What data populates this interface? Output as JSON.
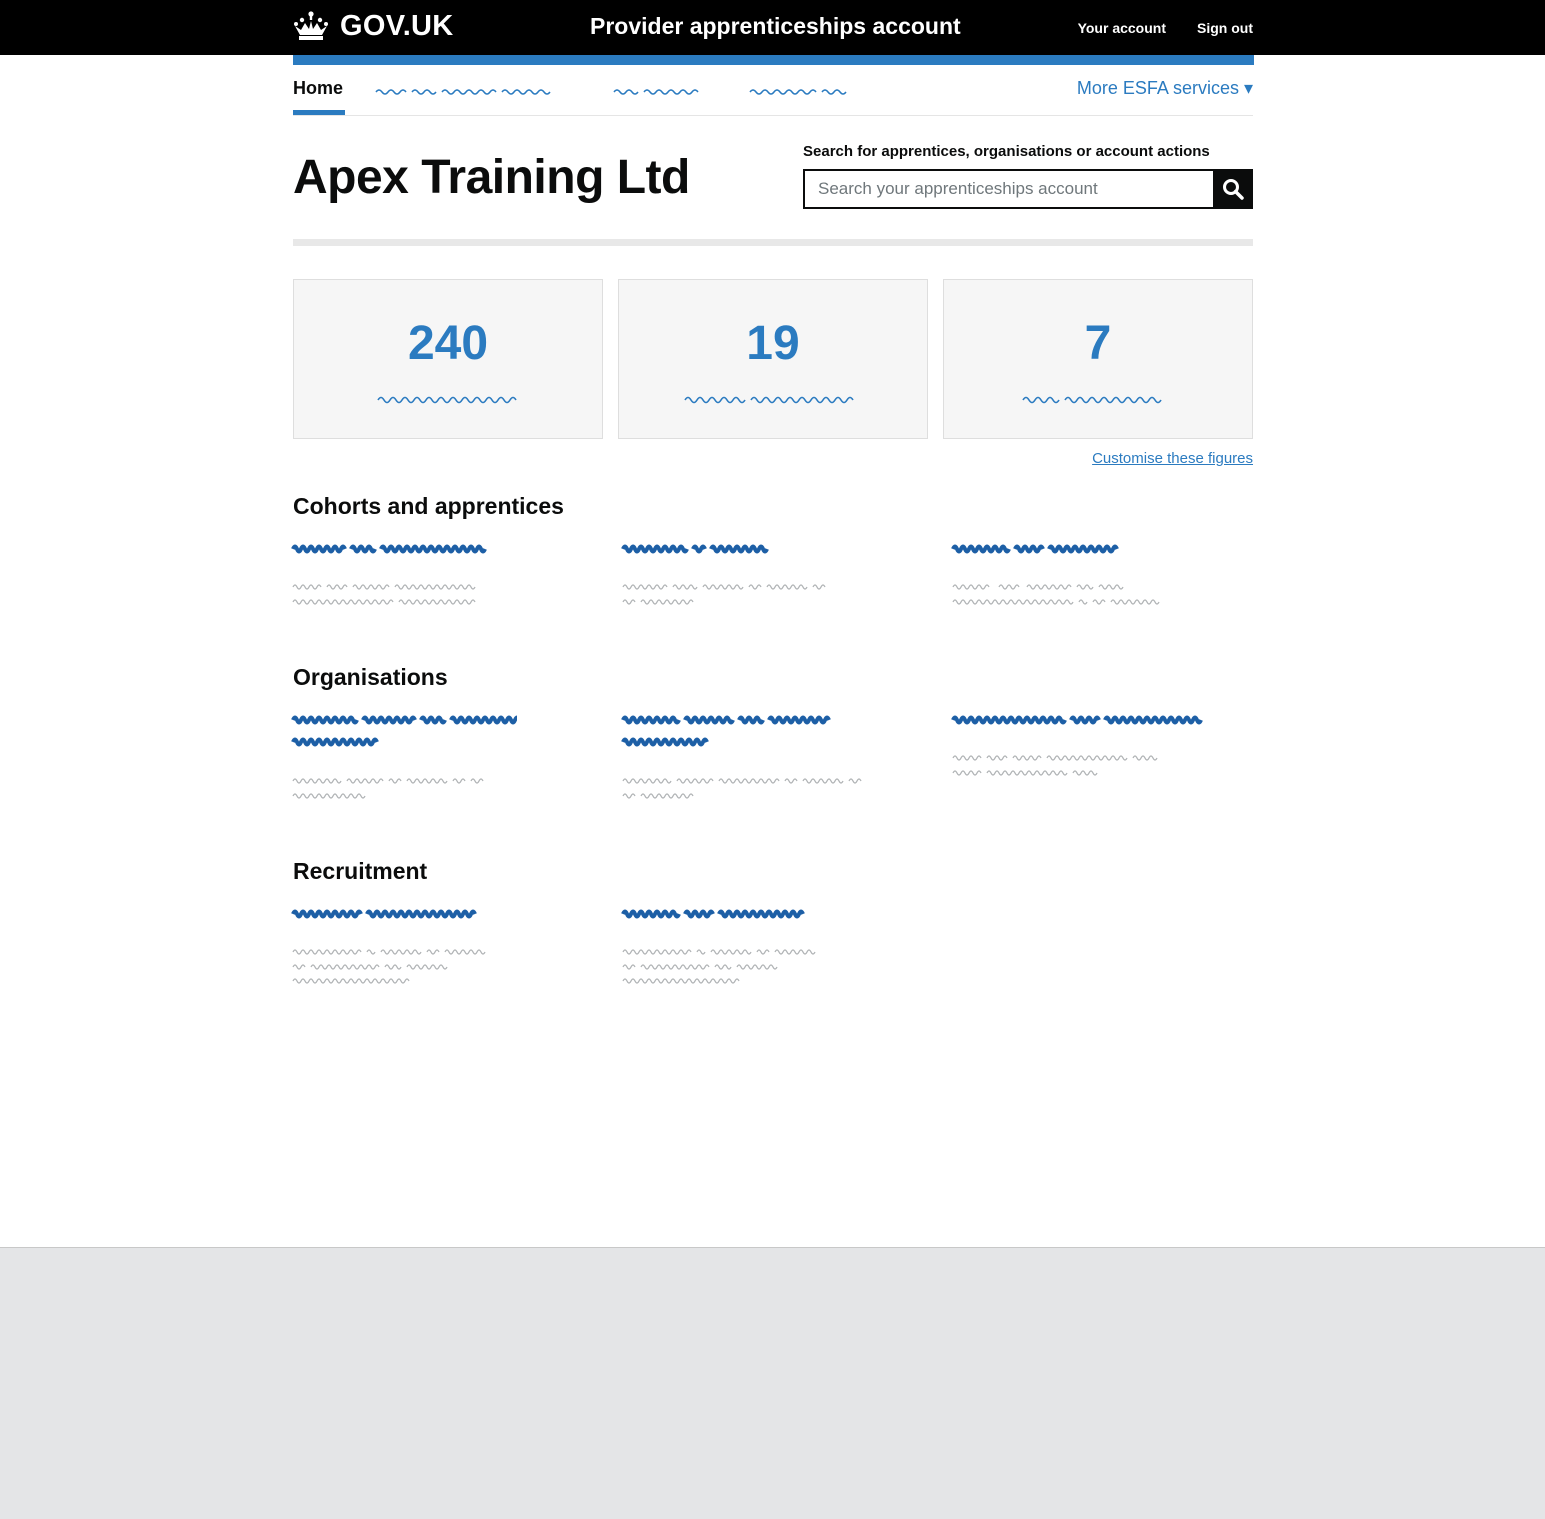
{
  "header": {
    "logo_text": "GOV.UK",
    "service_name": "Provider apprenticeships account",
    "links": [
      "Your account",
      "Sign out"
    ]
  },
  "nav": {
    "home": "Home",
    "more_services": "More ESFA services ▾"
  },
  "page_title": "Apex Training Ltd",
  "search": {
    "label": "Search for apprentices, organisations or account actions",
    "placeholder": "Search your apprenticeships account"
  },
  "stats": [
    {
      "value": "240"
    },
    {
      "value": "19"
    },
    {
      "value": "7"
    }
  ],
  "customise_link": "Customise these figures",
  "sections": {
    "cohorts": "Cohorts and apprentices",
    "organisations": "Organisations",
    "recruitment": "Recruitment"
  },
  "colors": {
    "link_blue": "#2b7bc0",
    "heavy_link_blue": "#1d5fa6",
    "grey_text": "#b1b4b6",
    "footer_bg": "#e4e5e7"
  }
}
